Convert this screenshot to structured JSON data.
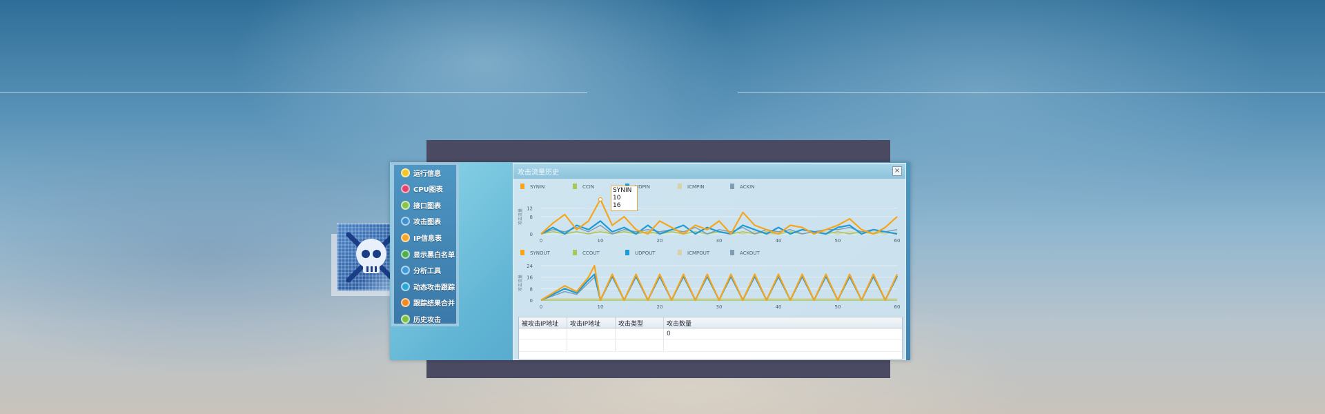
{
  "menu": {
    "items": [
      {
        "label": "运行信息",
        "icon": "info-icon",
        "color": "#f3c623"
      },
      {
        "label": "CPU图表",
        "icon": "cpu-chart-icon",
        "color": "#e0446a"
      },
      {
        "label": "接口图表",
        "icon": "interface-chart-icon",
        "color": "#8bc34a"
      },
      {
        "label": "攻击图表",
        "icon": "attack-chart-icon",
        "color": "#3d8fd1"
      },
      {
        "label": "IP信息表",
        "icon": "ip-table-icon",
        "color": "#f5a623"
      },
      {
        "label": "显示黑白名单",
        "icon": "blacklist-icon",
        "color": "#4caf50"
      },
      {
        "label": "分析工具",
        "icon": "analysis-tool-icon",
        "color": "#3b9ad9"
      },
      {
        "label": "动态攻击跟踪",
        "icon": "tracking-icon",
        "color": "#29a6d8"
      },
      {
        "label": "跟踪结果合并",
        "icon": "merge-icon",
        "color": "#f08a24"
      },
      {
        "label": "历史攻击",
        "icon": "history-icon",
        "color": "#7cc242"
      }
    ]
  },
  "panel": {
    "title": "攻击流量历史",
    "close_label": "×"
  },
  "tooltip": {
    "series": "SYNIN",
    "x": "10",
    "y": "16"
  },
  "charts": {
    "colors": [
      "#f5a51e",
      "#a8c75a",
      "#1e9bd7",
      "#d9d2a8",
      "#7f9db3"
    ],
    "in": {
      "legend": [
        "SYNIN",
        "CCIN",
        "UDPIN",
        "ICMPIN",
        "ACKIN"
      ],
      "ylabel": "攻击流量",
      "yticks": [
        "12",
        "8",
        "0"
      ],
      "xticks": [
        "0",
        "10",
        "20",
        "30",
        "40",
        "50",
        "60"
      ]
    },
    "out": {
      "legend": [
        "SYNOUT",
        "CCOUT",
        "UDPOUT",
        "ICMPOUT",
        "ACKOUT"
      ],
      "ylabel": "攻击流量",
      "yticks": [
        "24",
        "16",
        "8",
        "0"
      ],
      "xticks": [
        "0",
        "10",
        "20",
        "30",
        "40",
        "50",
        "60"
      ]
    }
  },
  "chart_data": [
    {
      "type": "line",
      "x": [
        0,
        2,
        4,
        6,
        8,
        10,
        12,
        14,
        16,
        18,
        20,
        22,
        24,
        26,
        28,
        30,
        32,
        34,
        36,
        38,
        40,
        42,
        44,
        46,
        48,
        50,
        52,
        54,
        56,
        58,
        60
      ],
      "xlim": [
        0,
        60
      ],
      "ylim": [
        0,
        16
      ],
      "series": [
        {
          "name": "SYNIN",
          "values": [
            0,
            5,
            9,
            2,
            6,
            16,
            4,
            8,
            2,
            0,
            6,
            3,
            0,
            4,
            2,
            6,
            0,
            10,
            4,
            2,
            0,
            4,
            3,
            0,
            2,
            4,
            7,
            2,
            0,
            3,
            8
          ]
        },
        {
          "name": "CCIN",
          "values": [
            0,
            1,
            0,
            1,
            0,
            1,
            0,
            1,
            0,
            1,
            0,
            1,
            0,
            1,
            0,
            1,
            0,
            1,
            0,
            1,
            0,
            1,
            0,
            1,
            0,
            1,
            0,
            1,
            0,
            1,
            0
          ]
        },
        {
          "name": "UDPIN",
          "values": [
            0,
            3,
            0,
            4,
            2,
            6,
            1,
            3,
            0,
            4,
            0,
            2,
            4,
            0,
            3,
            1,
            0,
            4,
            2,
            0,
            3,
            0,
            2,
            1,
            0,
            3,
            4,
            0,
            2,
            1,
            0
          ]
        },
        {
          "name": "ICMPIN",
          "values": [
            0,
            1,
            1,
            1,
            0,
            2,
            0,
            1,
            1,
            0,
            1,
            1,
            0,
            1,
            0,
            1,
            1,
            0,
            1,
            0,
            0,
            1,
            0,
            1,
            1,
            0,
            1,
            0,
            1,
            0,
            1
          ]
        },
        {
          "name": "ACKIN",
          "values": [
            0,
            2,
            1,
            3,
            1,
            4,
            0,
            2,
            1,
            2,
            1,
            2,
            1,
            3,
            0,
            2,
            1,
            3,
            0,
            2,
            1,
            2,
            0,
            1,
            2,
            2,
            3,
            1,
            2,
            1,
            2
          ]
        }
      ]
    },
    {
      "type": "line",
      "x": [
        0,
        2,
        4,
        6,
        8,
        9,
        10,
        12,
        14,
        16,
        18,
        20,
        22,
        24,
        26,
        28,
        30,
        32,
        34,
        36,
        38,
        40,
        42,
        44,
        46,
        48,
        50,
        52,
        54,
        56,
        58,
        60
      ],
      "xlim": [
        0,
        60
      ],
      "ylim": [
        0,
        24
      ],
      "series": [
        {
          "name": "SYNOUT",
          "values": [
            0,
            5,
            10,
            6,
            16,
            24,
            0,
            18,
            0,
            18,
            0,
            18,
            0,
            18,
            0,
            18,
            0,
            18,
            0,
            18,
            0,
            18,
            0,
            18,
            0,
            18,
            0,
            18,
            0,
            18,
            0,
            18
          ]
        },
        {
          "name": "CCOUT",
          "values": [
            0,
            0,
            0,
            0,
            0,
            0,
            0,
            0,
            0,
            0,
            0,
            0,
            0,
            0,
            0,
            0,
            0,
            0,
            0,
            0,
            0,
            0,
            0,
            0,
            0,
            0,
            0,
            0,
            0,
            0,
            0,
            0
          ]
        },
        {
          "name": "UDPOUT",
          "values": [
            0,
            4,
            8,
            5,
            14,
            18,
            0,
            17,
            0,
            17,
            0,
            17,
            0,
            17,
            0,
            17,
            0,
            17,
            0,
            17,
            0,
            17,
            0,
            17,
            0,
            17,
            0,
            17,
            0,
            17,
            0,
            17
          ]
        },
        {
          "name": "ICMPOUT",
          "values": [
            0,
            1,
            1,
            1,
            1,
            1,
            1,
            1,
            1,
            1,
            1,
            1,
            1,
            1,
            1,
            1,
            1,
            1,
            1,
            1,
            1,
            1,
            1,
            1,
            1,
            1,
            1,
            1,
            1,
            1,
            1,
            1
          ]
        },
        {
          "name": "ACKOUT",
          "values": [
            0,
            3,
            6,
            4,
            12,
            16,
            0,
            16,
            0,
            16,
            0,
            16,
            0,
            16,
            0,
            16,
            0,
            16,
            0,
            16,
            0,
            16,
            0,
            16,
            0,
            16,
            0,
            16,
            0,
            16,
            0,
            16
          ]
        }
      ]
    }
  ],
  "table": {
    "headers": [
      "被攻击IP地址",
      "攻击IP地址",
      "攻击类型",
      "攻击数量"
    ],
    "rows": [
      [
        "",
        "",
        "",
        "0"
      ],
      [
        "",
        "",
        "",
        ""
      ]
    ]
  }
}
